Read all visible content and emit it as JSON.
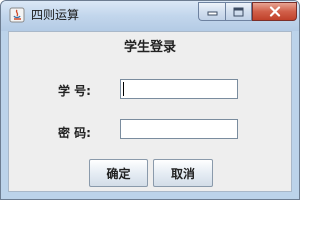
{
  "window": {
    "title": "四则运算",
    "controls": {
      "minimize_icon": "minimize-icon",
      "maximize_icon": "maximize-icon",
      "close_icon": "close-icon"
    }
  },
  "form": {
    "title": "学生登录",
    "student_id_label": "学 号:",
    "student_id_value": "",
    "password_label": "密 码:",
    "password_value": ""
  },
  "buttons": {
    "confirm": "确定",
    "cancel": "取消"
  },
  "colors": {
    "titlebar": "#c2d6ec",
    "client_bg": "#eeeeee",
    "close_button": "#c0412a"
  }
}
